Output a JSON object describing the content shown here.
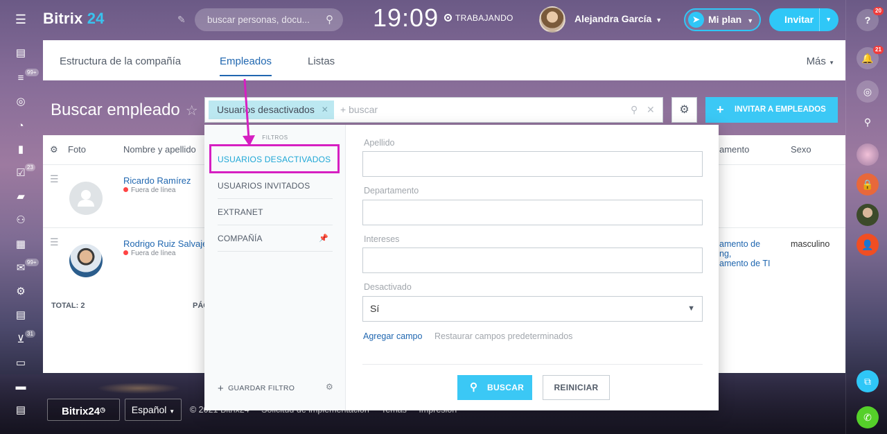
{
  "header": {
    "logo_main": "Bitrix",
    "logo_num": "24",
    "search_placeholder": "buscar personas, docu...",
    "clock": "19:09",
    "work_status": "TRABAJANDO",
    "user_name": "Alejandra García",
    "plan_label": "Mi plan",
    "invite_label": "Invitar"
  },
  "leftbar": {
    "badges": [
      "99+",
      "23",
      "99+",
      "31"
    ]
  },
  "rightbar": {
    "help_badge": "20",
    "notif_badge": "21"
  },
  "tabs": {
    "items": [
      "Estructura de la compañía",
      "Empleados",
      "Listas"
    ],
    "more": "Más"
  },
  "page": {
    "title": "Buscar empleado"
  },
  "filter": {
    "chip": "Usuarios desactivados",
    "search_placeholder": "+ buscar",
    "invite_employees": "INVITAR A EMPLEADOS"
  },
  "table": {
    "headers": [
      "Foto",
      "Nombre y apellido",
      "amento",
      "Sexo"
    ],
    "rows": [
      {
        "name": "Ricardo Ramírez",
        "status": "Fuera de línea",
        "dept": "",
        "sex": ""
      },
      {
        "name": "Rodrigo Ruiz Salvaje",
        "status": "Fuera de línea",
        "dept_lines": [
          "amento de",
          "ng,",
          "amento de TI"
        ],
        "sex": "masculino"
      }
    ],
    "total": "TOTAL: 2",
    "pag": "PÁC"
  },
  "popup": {
    "filters_title": "FILTROS",
    "presets": [
      "USUARIOS DESACTIVADOS",
      "USUARIOS INVITADOS",
      "EXTRANET",
      "COMPAÑÍA"
    ],
    "save_filter": "GUARDAR FILTRO",
    "fields": [
      {
        "label": "Apellido",
        "value": ""
      },
      {
        "label": "Departamento",
        "value": ""
      },
      {
        "label": "Intereses",
        "value": ""
      }
    ],
    "deactivated_label": "Desactivado",
    "deactivated_value": "Sí",
    "add_field": "Agregar campo",
    "restore": "Restaurar campos predeterminados",
    "search_btn": "BUSCAR",
    "reset_btn": "REINICIAR"
  },
  "footer": {
    "logo": "Bitrix24",
    "lang": "Español",
    "links": [
      "© 2021 Bitrix24",
      "Solicitud de implementación",
      "Temas",
      "Impresión"
    ]
  },
  "colors": {
    "accent": "#3bc8f5",
    "link": "#2067b0",
    "highlight": "#d61fc1"
  }
}
